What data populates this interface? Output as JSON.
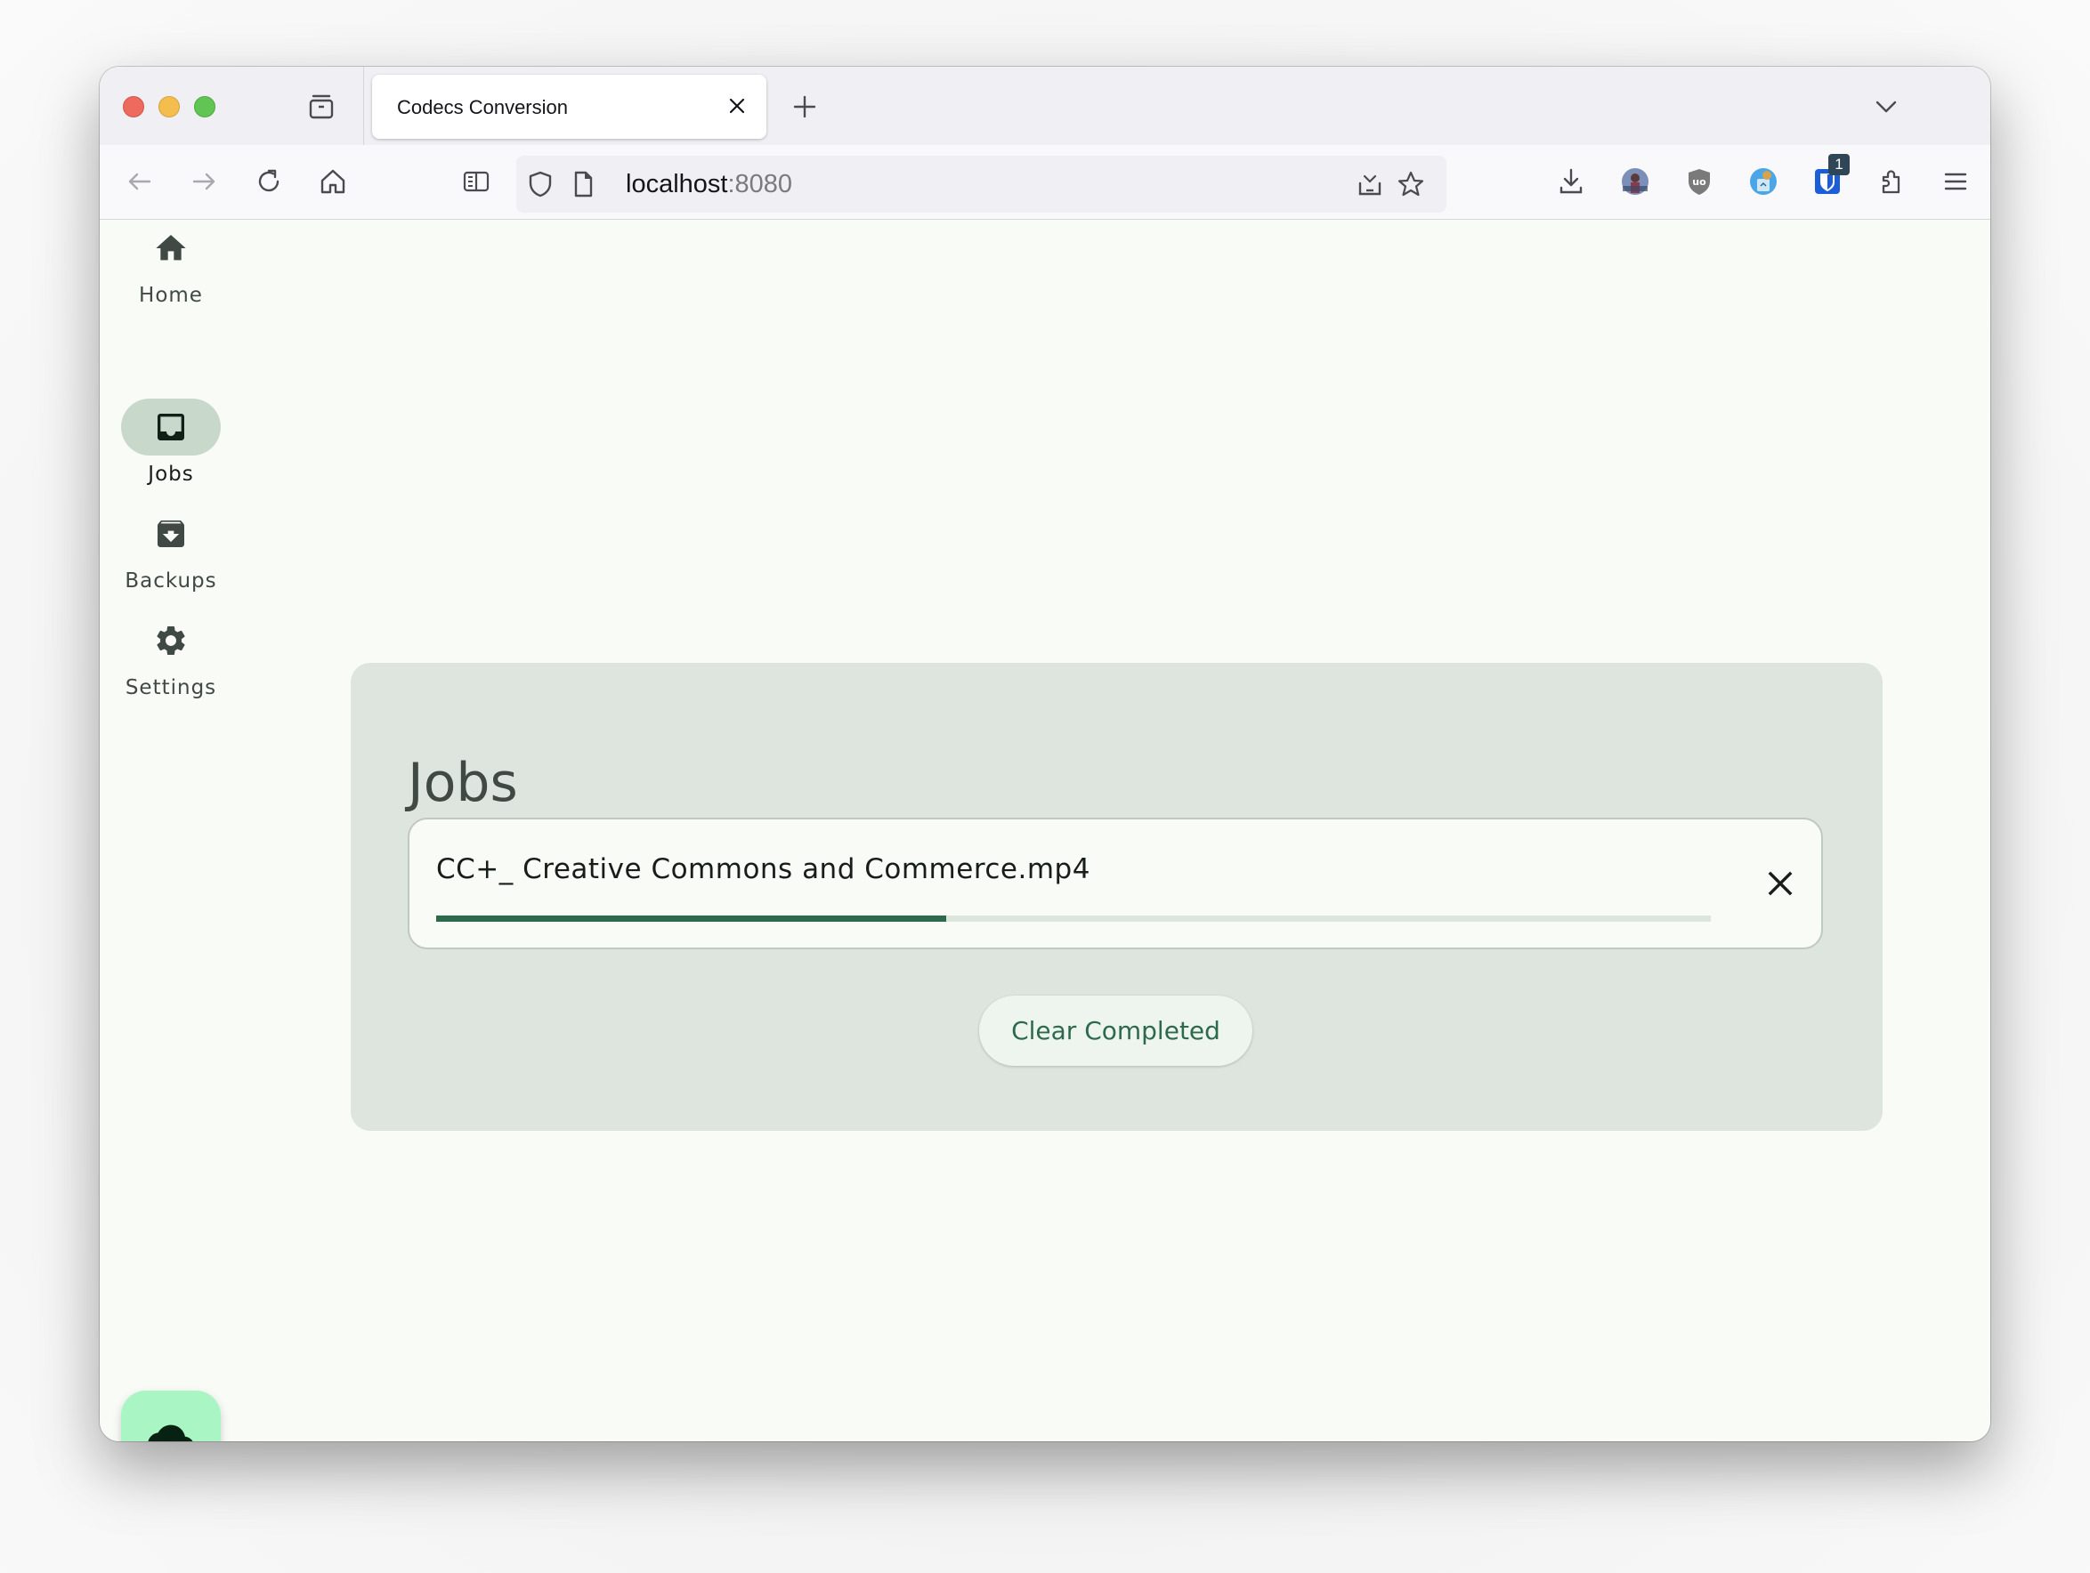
{
  "browser": {
    "tab": {
      "title": "Codecs Conversion"
    },
    "url": {
      "host": "localhost",
      "port": ":8080"
    },
    "extensions": [
      {
        "name": "profile-avatar"
      },
      {
        "name": "ublock-origin"
      },
      {
        "name": "cookie-autodelete"
      },
      {
        "name": "bitwarden",
        "badge": "1"
      }
    ]
  },
  "sidebar": {
    "items": [
      {
        "label": "Home",
        "icon": "home-icon",
        "active": false
      },
      {
        "label": "Jobs",
        "icon": "inbox-icon",
        "active": true
      },
      {
        "label": "Backups",
        "icon": "archive-icon",
        "active": false
      },
      {
        "label": "Settings",
        "icon": "gear-icon",
        "active": false
      }
    ],
    "fab_icon": "cloud-icon"
  },
  "main": {
    "title": "Jobs",
    "jobs": [
      {
        "name": "CC+_ Creative Commons and Commerce.mp4",
        "progress": 0.4
      }
    ],
    "clear_label": "Clear Completed"
  },
  "colors": {
    "accent": "#2d6a4b",
    "card_bg": "#dee5de",
    "active_nav": "#c8d9cb",
    "fab": "#aaf5c4"
  }
}
